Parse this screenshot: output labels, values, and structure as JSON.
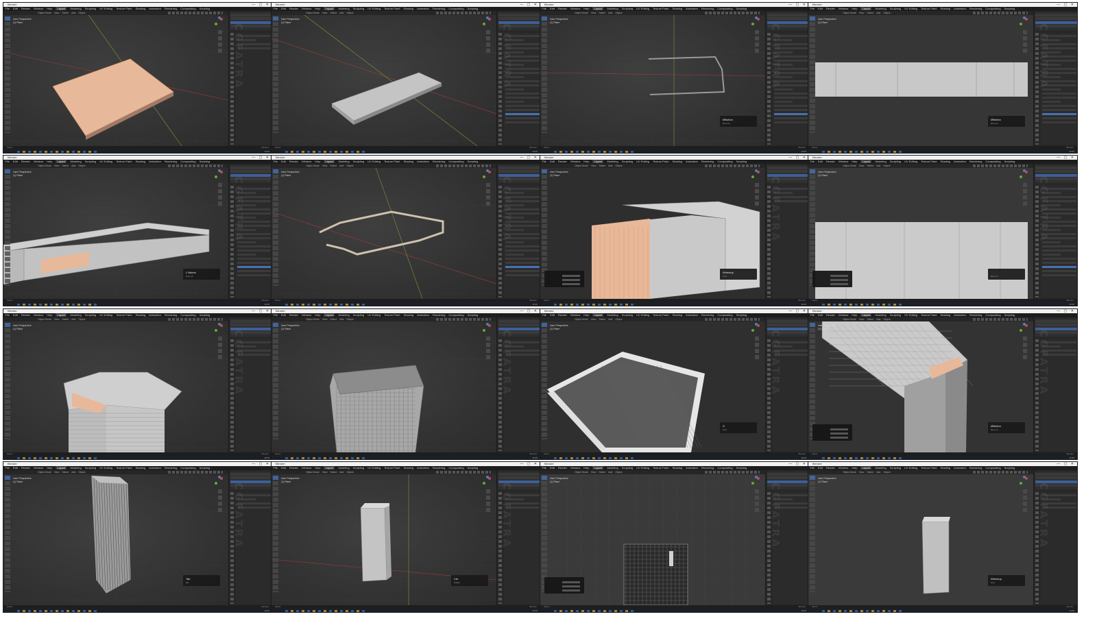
{
  "window": {
    "app_title": "Blender",
    "window_buttons": "— ▢ ✕"
  },
  "menu": {
    "items": [
      "File",
      "Edit",
      "Render",
      "Window",
      "Help"
    ],
    "workspaces": [
      "Layout",
      "Modeling",
      "Sculpting",
      "UV Editing",
      "Texture Paint",
      "Shading",
      "Animation",
      "Rendering",
      "Compositing",
      "Scripting"
    ],
    "active_workspace": "Layout"
  },
  "header": {
    "items": [
      "Object Mode",
      "View",
      "Select",
      "Add",
      "Object"
    ]
  },
  "viewport_info": {
    "line1": "User Perspective",
    "line2": "(1) Plane"
  },
  "status_bar": {
    "left": "Select",
    "right": "Blender"
  },
  "watermark": "CGFATRA",
  "taskbar": {
    "time": "10:45"
  },
  "tiles": [
    {
      "scene": "slab_selected",
      "hud": null,
      "sidebar_mode": "minimal"
    },
    {
      "scene": "slab",
      "hud": null,
      "sidebar_mode": "full"
    },
    {
      "scene": "outline_edges",
      "hud": {
        "key": "MButton",
        "sub": "Move Loc"
      },
      "sidebar_mode": "full"
    },
    {
      "scene": "wall_front",
      "hud": {
        "key": "MButton",
        "sub": "Move Loc"
      },
      "sidebar_mode": "full"
    },
    {
      "scene": "walls_persp",
      "hud": {
        "key": "L.Button",
        "sub": "Move Loc"
      },
      "sidebar_mode": "full"
    },
    {
      "scene": "outline_3d",
      "hud": null,
      "sidebar_mode": "full"
    },
    {
      "scene": "tall_walls_close",
      "hud": {
        "key": "Wheelup",
        "sub": "Zoom"
      },
      "sidebar_mode": "minimal",
      "op_panel": true
    },
    {
      "scene": "wall_front_tall",
      "hud": {
        "key": "",
        "sub": "Move Loc"
      },
      "sidebar_mode": "full",
      "op_panel": true
    },
    {
      "scene": "tower_top_open",
      "hud": null,
      "sidebar_mode": "minimal"
    },
    {
      "scene": "tower_wire_top",
      "hud": null,
      "sidebar_mode": "minimal"
    },
    {
      "scene": "tower_inside",
      "hud": {
        "key": "G",
        "sub": "Move"
      },
      "sidebar_mode": "minimal"
    },
    {
      "scene": "tower_roof_grid",
      "hud": {
        "key": "MButton",
        "sub": "Move Loc"
      },
      "sidebar_mode": "minimal",
      "op_panel": true
    },
    {
      "scene": "tower_full_wire",
      "hud": {
        "key": "Tab",
        "sub": "Edit"
      },
      "sidebar_mode": "minimal"
    },
    {
      "scene": "tower_small",
      "hud": {
        "key": "Ctrl",
        "sub": "Modifier"
      },
      "sidebar_mode": "minimal"
    },
    {
      "scene": "tower_ortho_grid",
      "hud": null,
      "sidebar_mode": "minimal",
      "op_panel": true
    },
    {
      "scene": "tower_small_ortho",
      "hud": {
        "key": "Wheelup",
        "sub": "Zoom"
      },
      "sidebar_mode": "minimal"
    }
  ],
  "colors": {
    "viewport_bg": "#3a3a3a",
    "selected_face": "#e8b89a",
    "mesh_grey": "#c4c4c4",
    "accent_blue": "#4772b3",
    "x_axis": "#a83a3a",
    "y_axis": "#7a9a3a"
  }
}
